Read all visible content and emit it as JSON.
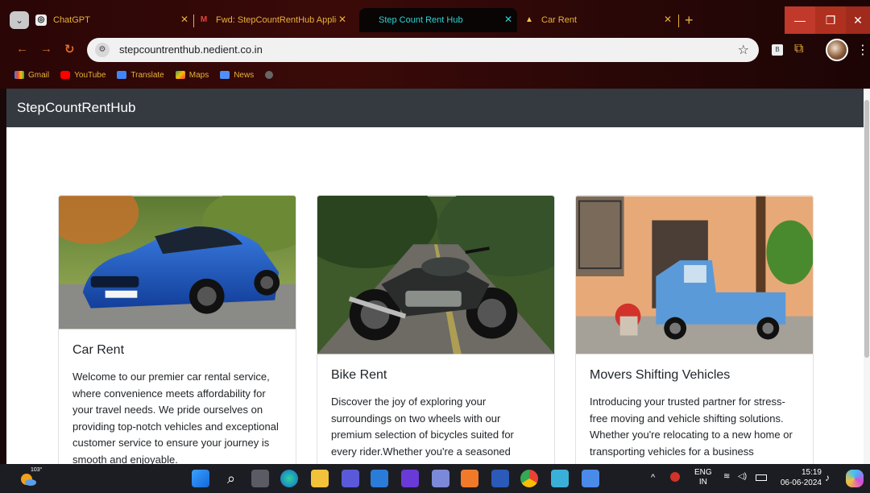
{
  "browser": {
    "tabs": [
      {
        "title": "ChatGPT",
        "active": false
      },
      {
        "title": "Fwd: StepCountRentHub Applic",
        "active": false
      },
      {
        "title": "Step Count Rent Hub",
        "active": true
      },
      {
        "title": "Car Rent",
        "active": false
      }
    ],
    "new_tab_symbol": "+",
    "url": "stepcountrenthub.nedient.co.in",
    "bookmarks": [
      {
        "label": "Gmail",
        "icon": "gmail-icon"
      },
      {
        "label": "YouTube",
        "icon": "youtube-icon"
      },
      {
        "label": "Translate",
        "icon": "translate-icon"
      },
      {
        "label": "Maps",
        "icon": "maps-icon"
      },
      {
        "label": "News",
        "icon": "news-icon"
      }
    ]
  },
  "site": {
    "brand": "StepCountRentHub",
    "cards": [
      {
        "title": "Car Rent",
        "image": "blue-sedan-photo",
        "text": "Welcome to our premier car rental service, where convenience meets affordability for your travel needs. We pride ourselves on providing top-notch vehicles and exceptional customer service to ensure your journey is smooth and enjoyable."
      },
      {
        "title": "Bike Rent",
        "image": "motorcycle-photo",
        "text": "Discover the joy of exploring your surroundings on two wheels with our premium selection of bicycles suited for every rider.Whether you're a seasoned"
      },
      {
        "title": "Movers Shifting Vehicles",
        "image": "blue-pickup-truck-photo",
        "text": "Introducing your trusted partner for stress-free moving and vehicle shifting solutions. Whether you're relocating to a new home or transporting vehicles for a business"
      }
    ]
  },
  "taskbar": {
    "weather_temp": "103°",
    "language": "ENG",
    "region": "IN",
    "time": "15:19",
    "date": "06-06-2024"
  }
}
